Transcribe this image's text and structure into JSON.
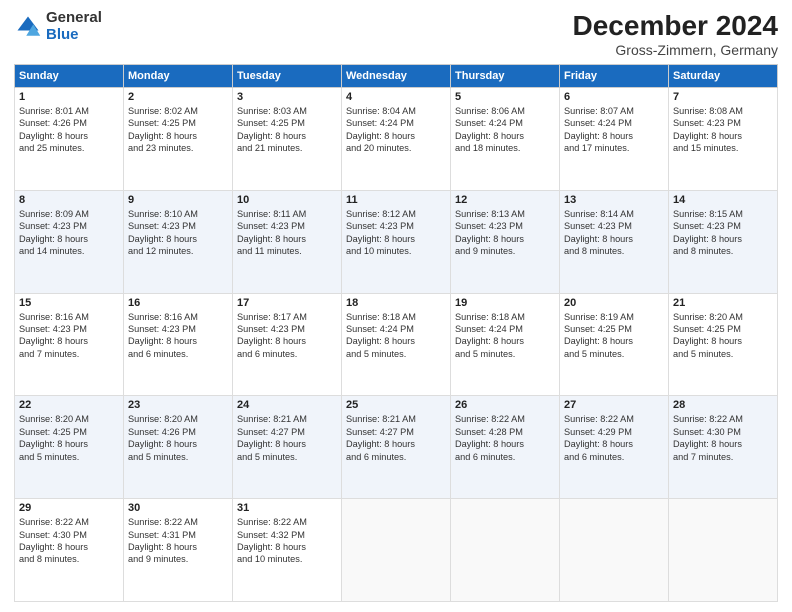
{
  "logo": {
    "general": "General",
    "blue": "Blue"
  },
  "header": {
    "title": "December 2024",
    "location": "Gross-Zimmern, Germany"
  },
  "weekdays": [
    "Sunday",
    "Monday",
    "Tuesday",
    "Wednesday",
    "Thursday",
    "Friday",
    "Saturday"
  ],
  "weeks": [
    [
      {
        "day": "1",
        "info": "Sunrise: 8:01 AM\nSunset: 4:26 PM\nDaylight: 8 hours\nand 25 minutes."
      },
      {
        "day": "2",
        "info": "Sunrise: 8:02 AM\nSunset: 4:25 PM\nDaylight: 8 hours\nand 23 minutes."
      },
      {
        "day": "3",
        "info": "Sunrise: 8:03 AM\nSunset: 4:25 PM\nDaylight: 8 hours\nand 21 minutes."
      },
      {
        "day": "4",
        "info": "Sunrise: 8:04 AM\nSunset: 4:24 PM\nDaylight: 8 hours\nand 20 minutes."
      },
      {
        "day": "5",
        "info": "Sunrise: 8:06 AM\nSunset: 4:24 PM\nDaylight: 8 hours\nand 18 minutes."
      },
      {
        "day": "6",
        "info": "Sunrise: 8:07 AM\nSunset: 4:24 PM\nDaylight: 8 hours\nand 17 minutes."
      },
      {
        "day": "7",
        "info": "Sunrise: 8:08 AM\nSunset: 4:23 PM\nDaylight: 8 hours\nand 15 minutes."
      }
    ],
    [
      {
        "day": "8",
        "info": "Sunrise: 8:09 AM\nSunset: 4:23 PM\nDaylight: 8 hours\nand 14 minutes."
      },
      {
        "day": "9",
        "info": "Sunrise: 8:10 AM\nSunset: 4:23 PM\nDaylight: 8 hours\nand 12 minutes."
      },
      {
        "day": "10",
        "info": "Sunrise: 8:11 AM\nSunset: 4:23 PM\nDaylight: 8 hours\nand 11 minutes."
      },
      {
        "day": "11",
        "info": "Sunrise: 8:12 AM\nSunset: 4:23 PM\nDaylight: 8 hours\nand 10 minutes."
      },
      {
        "day": "12",
        "info": "Sunrise: 8:13 AM\nSunset: 4:23 PM\nDaylight: 8 hours\nand 9 minutes."
      },
      {
        "day": "13",
        "info": "Sunrise: 8:14 AM\nSunset: 4:23 PM\nDaylight: 8 hours\nand 8 minutes."
      },
      {
        "day": "14",
        "info": "Sunrise: 8:15 AM\nSunset: 4:23 PM\nDaylight: 8 hours\nand 8 minutes."
      }
    ],
    [
      {
        "day": "15",
        "info": "Sunrise: 8:16 AM\nSunset: 4:23 PM\nDaylight: 8 hours\nand 7 minutes."
      },
      {
        "day": "16",
        "info": "Sunrise: 8:16 AM\nSunset: 4:23 PM\nDaylight: 8 hours\nand 6 minutes."
      },
      {
        "day": "17",
        "info": "Sunrise: 8:17 AM\nSunset: 4:23 PM\nDaylight: 8 hours\nand 6 minutes."
      },
      {
        "day": "18",
        "info": "Sunrise: 8:18 AM\nSunset: 4:24 PM\nDaylight: 8 hours\nand 5 minutes."
      },
      {
        "day": "19",
        "info": "Sunrise: 8:18 AM\nSunset: 4:24 PM\nDaylight: 8 hours\nand 5 minutes."
      },
      {
        "day": "20",
        "info": "Sunrise: 8:19 AM\nSunset: 4:25 PM\nDaylight: 8 hours\nand 5 minutes."
      },
      {
        "day": "21",
        "info": "Sunrise: 8:20 AM\nSunset: 4:25 PM\nDaylight: 8 hours\nand 5 minutes."
      }
    ],
    [
      {
        "day": "22",
        "info": "Sunrise: 8:20 AM\nSunset: 4:25 PM\nDaylight: 8 hours\nand 5 minutes."
      },
      {
        "day": "23",
        "info": "Sunrise: 8:20 AM\nSunset: 4:26 PM\nDaylight: 8 hours\nand 5 minutes."
      },
      {
        "day": "24",
        "info": "Sunrise: 8:21 AM\nSunset: 4:27 PM\nDaylight: 8 hours\nand 5 minutes."
      },
      {
        "day": "25",
        "info": "Sunrise: 8:21 AM\nSunset: 4:27 PM\nDaylight: 8 hours\nand 6 minutes."
      },
      {
        "day": "26",
        "info": "Sunrise: 8:22 AM\nSunset: 4:28 PM\nDaylight: 8 hours\nand 6 minutes."
      },
      {
        "day": "27",
        "info": "Sunrise: 8:22 AM\nSunset: 4:29 PM\nDaylight: 8 hours\nand 6 minutes."
      },
      {
        "day": "28",
        "info": "Sunrise: 8:22 AM\nSunset: 4:30 PM\nDaylight: 8 hours\nand 7 minutes."
      }
    ],
    [
      {
        "day": "29",
        "info": "Sunrise: 8:22 AM\nSunset: 4:30 PM\nDaylight: 8 hours\nand 8 minutes."
      },
      {
        "day": "30",
        "info": "Sunrise: 8:22 AM\nSunset: 4:31 PM\nDaylight: 8 hours\nand 9 minutes."
      },
      {
        "day": "31",
        "info": "Sunrise: 8:22 AM\nSunset: 4:32 PM\nDaylight: 8 hours\nand 10 minutes."
      },
      null,
      null,
      null,
      null
    ]
  ]
}
